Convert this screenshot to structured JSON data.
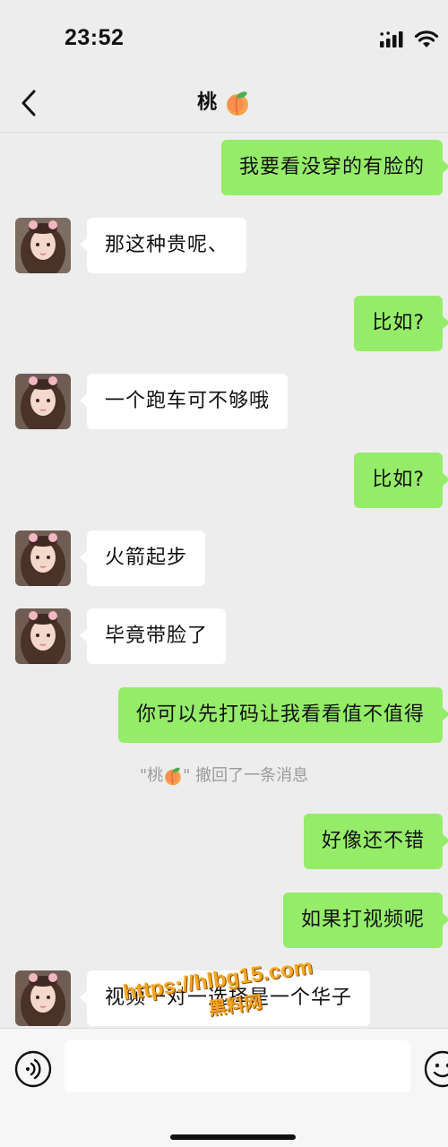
{
  "status_bar": {
    "time": "23:52"
  },
  "header": {
    "title": "桃"
  },
  "messages": [
    {
      "side": "right",
      "text": "我要看没穿的有脸的"
    },
    {
      "side": "left",
      "text": "那这种贵呢、"
    },
    {
      "side": "right",
      "text": "比如?"
    },
    {
      "side": "left",
      "text": "一个跑车可不够哦"
    },
    {
      "side": "right",
      "text": "比如?"
    },
    {
      "side": "left",
      "text": "火箭起步"
    },
    {
      "side": "left",
      "text": "毕竟带脸了"
    },
    {
      "side": "right",
      "text": "你可以先打码让我看看值不值得"
    },
    {
      "side": "system",
      "name": "\"桃",
      "name_close": "\"",
      "text": "撤回了一条消息"
    },
    {
      "side": "right",
      "text": "好像还不错"
    },
    {
      "side": "right",
      "text": "如果打视频呢"
    },
    {
      "side": "left",
      "text": "视频一对一选择是一个华子"
    }
  ],
  "watermark": {
    "url": "https://hlbg15.com",
    "label": "黑料网"
  },
  "input": {
    "placeholder": ""
  },
  "colors": {
    "background": "#ededed",
    "sent_bubble": "#95ec69",
    "received_bubble": "#ffffff",
    "system_text": "#9b9b9b"
  }
}
